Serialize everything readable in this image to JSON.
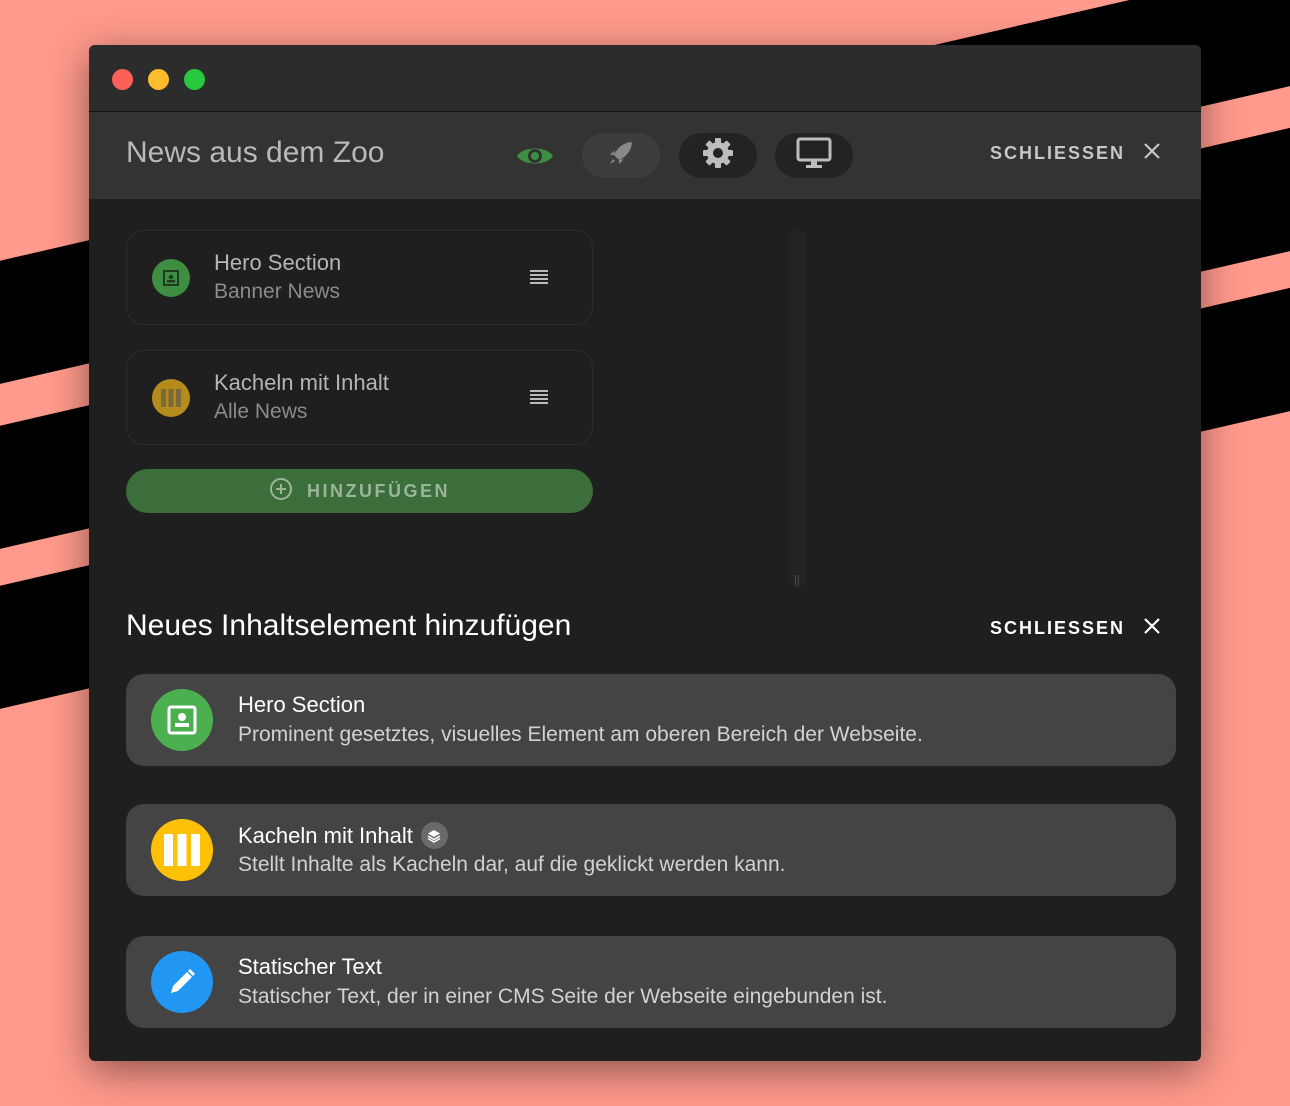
{
  "window": {
    "page_title": "News aus dem Zoo",
    "close_label": "SCHLIESSEN"
  },
  "toolbar": {
    "icons": [
      "eye-icon",
      "rocket-icon",
      "gear-icon",
      "monitor-icon"
    ]
  },
  "sections": [
    {
      "title": "Hero Section",
      "subtitle": "Banner News",
      "color": "#3e8e41",
      "icon": "image-icon"
    },
    {
      "title": "Kacheln mit Inhalt",
      "subtitle": "Alle News",
      "color": "#b58b1b",
      "icon": "columns-icon"
    }
  ],
  "add_button": {
    "label": "HINZUFÜGEN"
  },
  "add_panel": {
    "title": "Neues Inhaltselement hinzufügen",
    "close_label": "SCHLIESSEN",
    "options": [
      {
        "title": "Hero Section",
        "description": "Prominent gesetztes, visuelles Element am oberen Bereich der Webseite.",
        "color": "#4caf50",
        "icon": "image-icon"
      },
      {
        "title": "Kacheln mit Inhalt",
        "description": "Stellt Inhalte als Kacheln dar, auf die geklickt werden kann.",
        "color": "#ffc107",
        "icon": "columns-icon",
        "badge": "layers-icon"
      },
      {
        "title": "Statischer Text",
        "description": "Statischer Text, der in einer CMS Seite der Webseite eingebunden ist.",
        "color": "#2196f3",
        "icon": "pencil-icon"
      }
    ]
  },
  "colors": {
    "background": "#ff9a8c",
    "accent_green": "#3b6e3a",
    "window": "#1f1f1f"
  }
}
